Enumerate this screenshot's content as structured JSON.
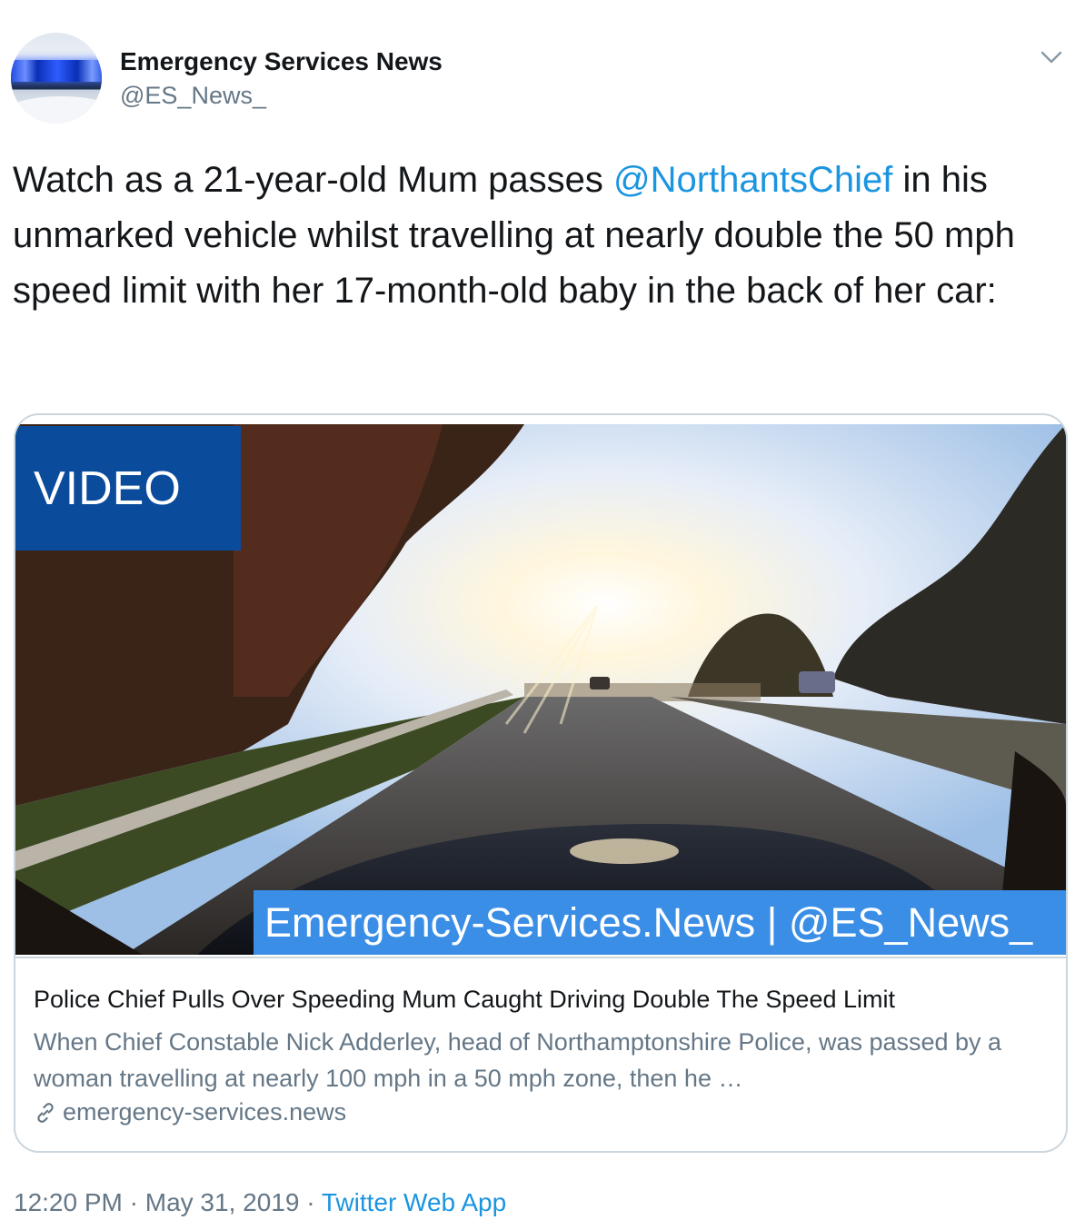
{
  "author": {
    "display_name": "Emergency Services News",
    "handle": "@ES_News_"
  },
  "icons": {
    "more": "chevron-down-icon",
    "link": "link-icon"
  },
  "tweet": {
    "text_before": "Watch as a 21-year-old Mum passes ",
    "mention": "@NorthantsChief",
    "text_after": " in his unmarked vehicle whilst travelling at nearly double the 50 mph speed limit with her 17-month-old baby in the back of her car:"
  },
  "card": {
    "video_label": "VIDEO",
    "watermark": "Emergency-Services.News | @ES_News_",
    "title": "Police Chief Pulls Over Speeding Mum Caught Driving Double The Speed Limit",
    "description": "When Chief Constable Nick Adderley, head of Northamptonshire Police, was passed by a woman travelling at nearly 100 mph in a 50 mph zone, then he …",
    "domain": "emergency-services.news"
  },
  "meta": {
    "time": "12:20 PM",
    "separator": " · ",
    "date": "May 31, 2019",
    "source": "Twitter Web App"
  },
  "colors": {
    "link": "#1b95e0",
    "secondary": "#657786",
    "video_tag": "#0a4b9b",
    "watermark": "#3a8ee6"
  }
}
